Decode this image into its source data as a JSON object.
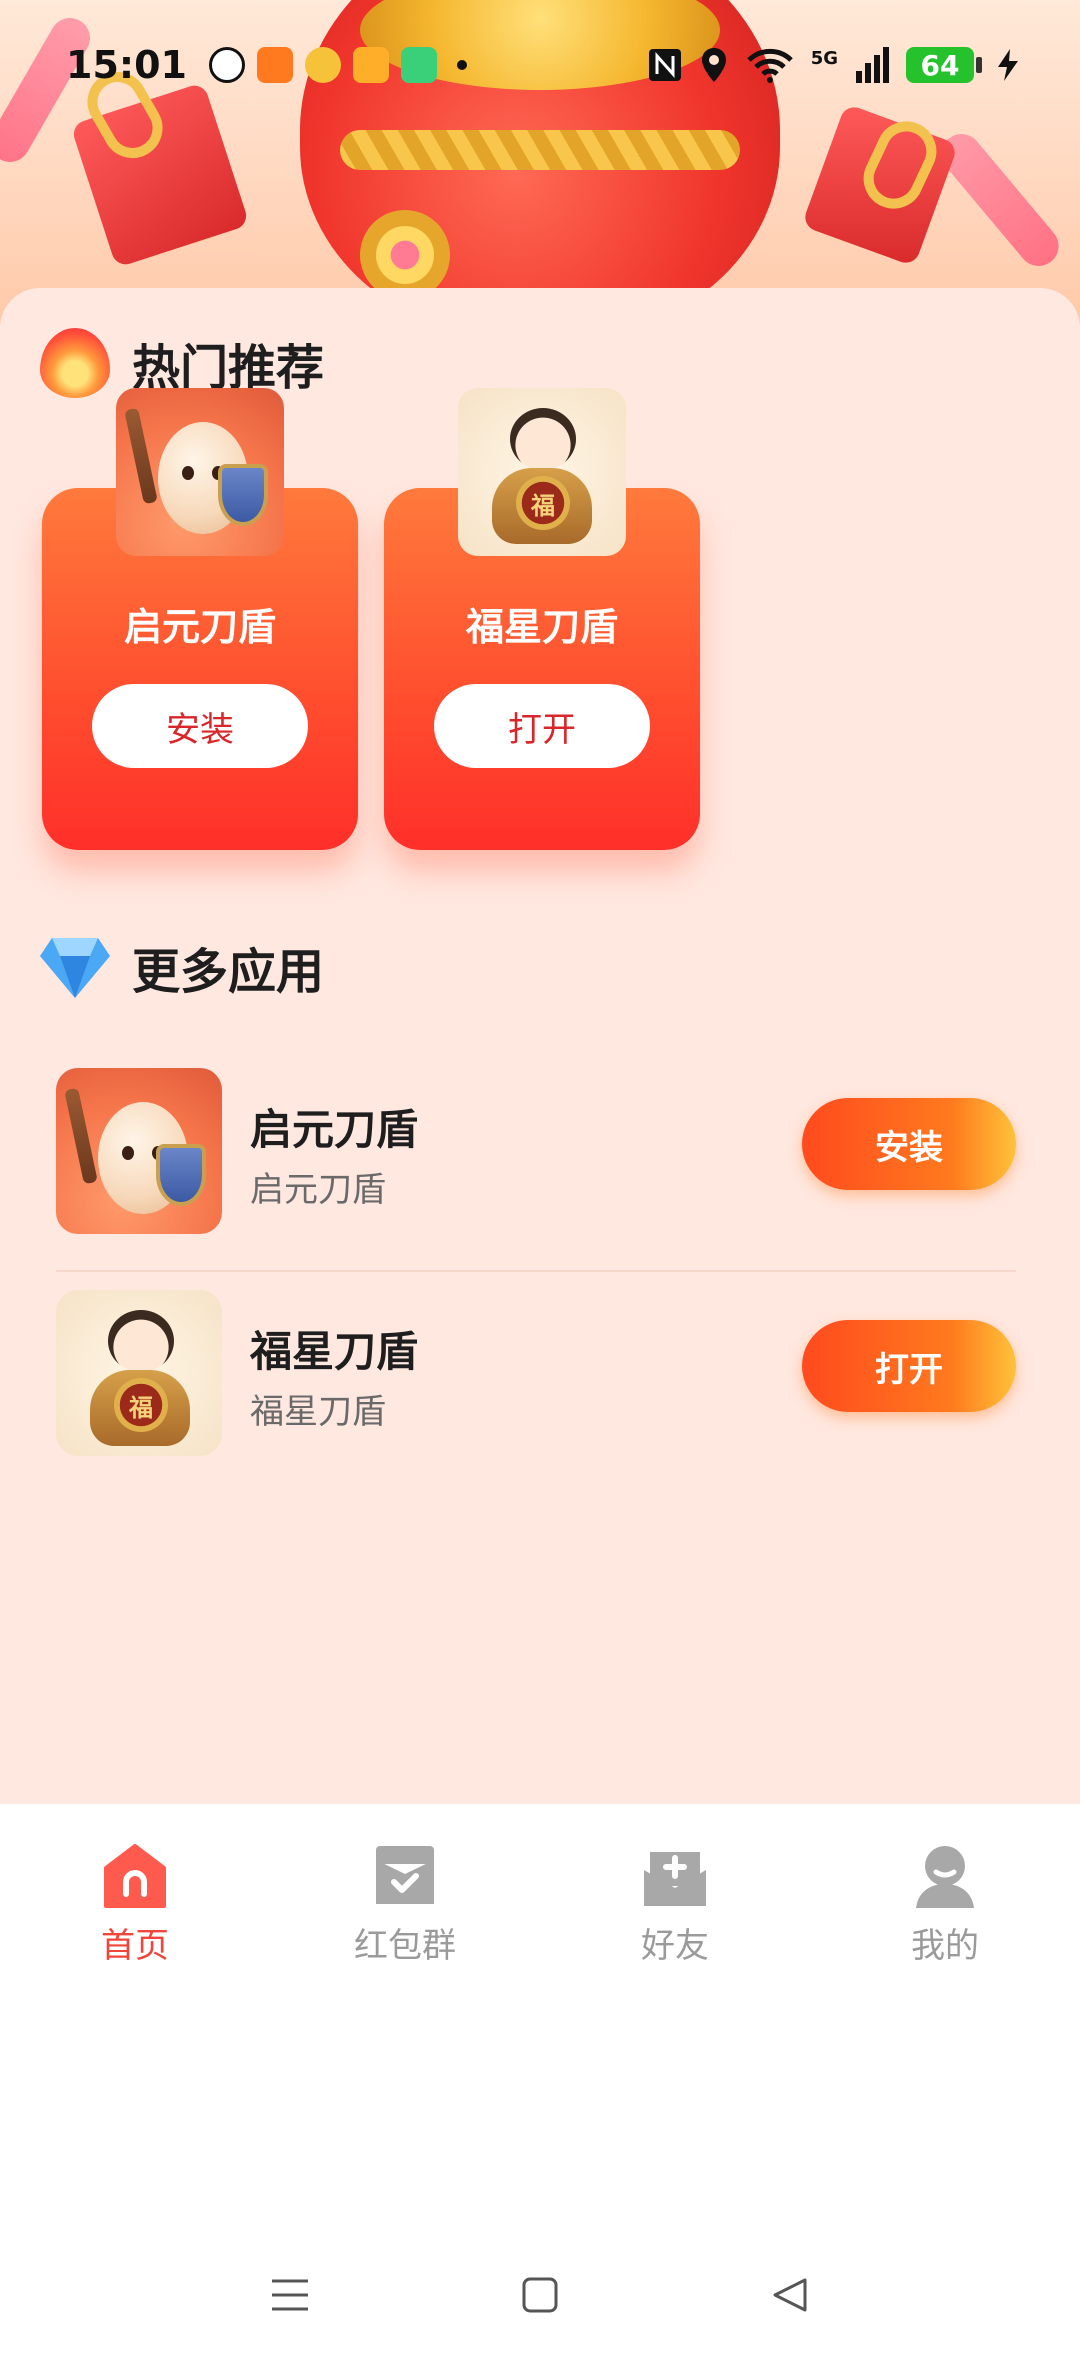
{
  "status_bar": {
    "time": "15:01",
    "battery_level": "64",
    "network": "5G",
    "notification_icons": [
      "qq-icon",
      "horse-app-icon",
      "weibo-icon",
      "fox-app-icon",
      "battery-saver-icon"
    ],
    "right_icons": [
      "nfc-icon",
      "location-icon",
      "wifi-icon",
      "signal-icon",
      "battery-icon",
      "charging-icon"
    ]
  },
  "hot_section": {
    "title": "热门推荐",
    "icon": "fire-icon",
    "cards": [
      {
        "name": "启元刀盾",
        "button": "安装",
        "thumb": "egg-warrior"
      },
      {
        "name": "福星刀盾",
        "button": "打开",
        "thumb": "lucky-boy"
      }
    ]
  },
  "more_section": {
    "title": "更多应用",
    "icon": "diamond-icon",
    "items": [
      {
        "title": "启元刀盾",
        "subtitle": "启元刀盾",
        "action": "安装",
        "thumb": "egg-warrior"
      },
      {
        "title": "福星刀盾",
        "subtitle": "福星刀盾",
        "action": "打开",
        "thumb": "lucky-boy"
      }
    ]
  },
  "bottom_nav": {
    "items": [
      {
        "label": "首页",
        "icon": "home-icon",
        "active": true
      },
      {
        "label": "红包群",
        "icon": "red-packet-group-icon",
        "active": false
      },
      {
        "label": "好友",
        "icon": "friends-icon",
        "active": false
      },
      {
        "label": "我的",
        "icon": "profile-icon",
        "active": false
      }
    ]
  },
  "colors": {
    "accent": "#f0453a",
    "card_gradient_top": "#ff7a3c",
    "card_gradient_bottom": "#ff2f2a",
    "content_bg": "#ffe8e0",
    "inactive_nav": "#9a9a9a"
  },
  "boy_medal_char": "福"
}
